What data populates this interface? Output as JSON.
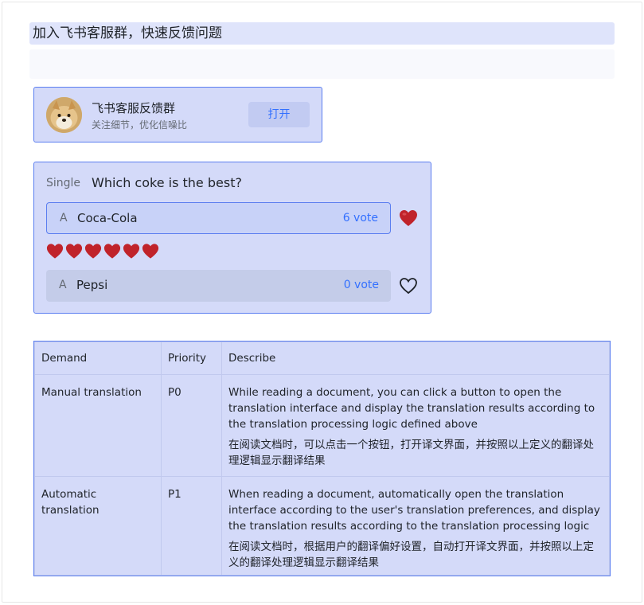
{
  "heading": "加入飞书客服群，快速反馈问题",
  "group": {
    "name": "飞书客服反馈群",
    "desc": "关注细节，优化信噪比",
    "button": "打开",
    "avatar_icon": "shiba-dog-avatar"
  },
  "poll": {
    "kind": "Single",
    "question": "Which coke is the best?",
    "options": [
      {
        "letter": "A",
        "label": "Coca-Cola",
        "votes": "6 vote",
        "liked": true,
        "voters": 6
      },
      {
        "letter": "A",
        "label": "Pepsi",
        "votes": "0 vote",
        "liked": false
      }
    ],
    "accent": "#3370ff",
    "heart_color": "#c0232b"
  },
  "table": {
    "headers": [
      "Demand",
      "Priority",
      "Describe"
    ],
    "rows": [
      {
        "demand": "Manual translation",
        "priority": "P0",
        "describe_en": "While reading a document, you can click a button to open the translation interface and display the translation results according to the translation processing logic defined above",
        "describe_zh": "在阅读文档时，可以点击一个按钮，打开译文界面，并按照以上定义的翻译处理逻辑显示翻译结果"
      },
      {
        "demand": "Automatic translation",
        "priority": "P1",
        "describe_en": "When reading a document, automatically open the translation interface according to the user's translation preferences, and display the translation results according to the translation processing logic",
        "describe_zh": "在阅读文档时，根据用户的翻译偏好设置，自动打开译文界面，并按照以上定义的翻译处理逻辑显示翻译结果"
      }
    ]
  }
}
